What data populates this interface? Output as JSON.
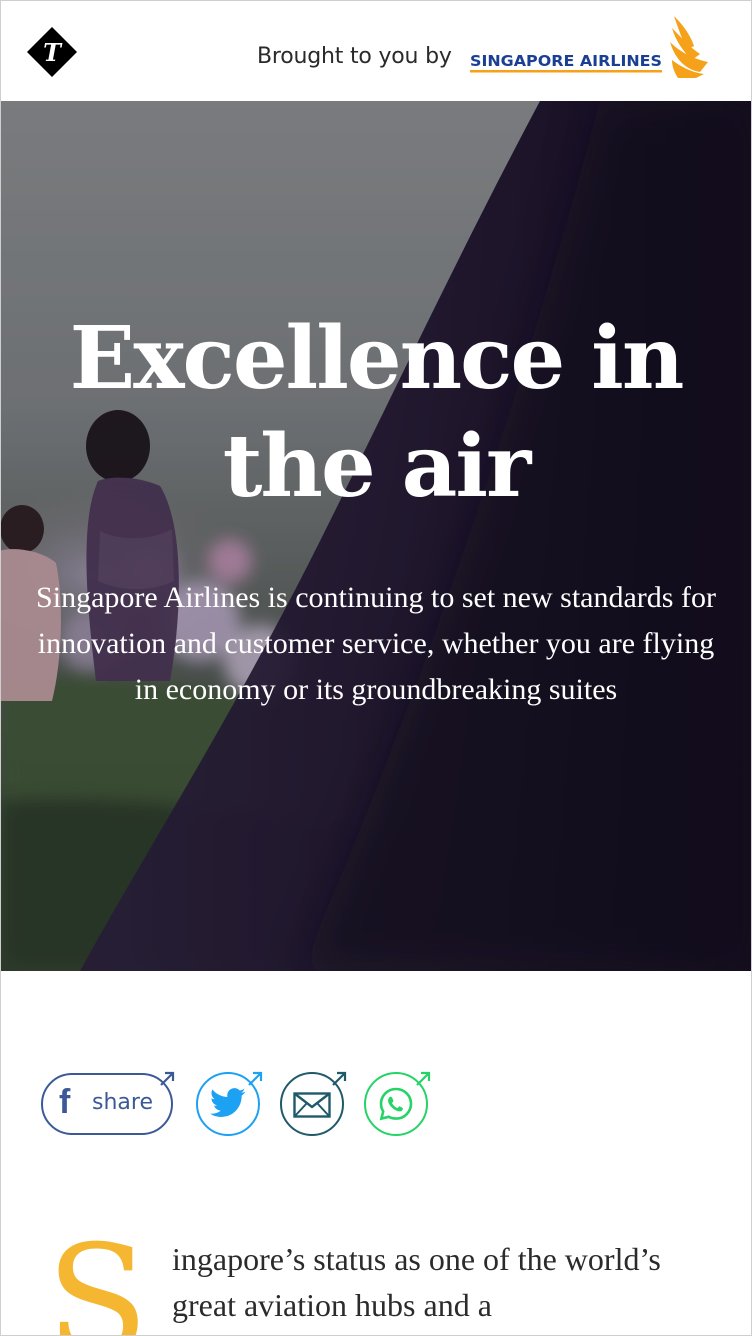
{
  "header": {
    "logo_icon": "telegraph-t-logo-icon",
    "sponsor_prefix": "Brought to you by",
    "sponsor_name": "SINGAPORE AIRLINES",
    "sponsor_logo_icon": "singapore-airlines-bird-icon"
  },
  "hero": {
    "title": "Excellence in the air",
    "subtitle": "Singapore Airlines is continuing to set new standards for innovation and customer service, whether you are flying in economy or its groundbreaking suites"
  },
  "share": {
    "facebook_label": "share",
    "icons": [
      "facebook-icon",
      "twitter-icon",
      "email-icon",
      "whatsapp-icon",
      "external-arrow-icon"
    ]
  },
  "article": {
    "dropcap": "S",
    "intro": "ingapore’s status as one of the world’s great aviation hubs and a"
  },
  "colors": {
    "facebook": "#3b5998",
    "twitter": "#1da1f2",
    "email": "#1f5a6b",
    "whatsapp": "#25d366",
    "dropcap": "#f5b731",
    "sia_blue": "#1b3f94",
    "sia_orange": "#f5a11a"
  }
}
